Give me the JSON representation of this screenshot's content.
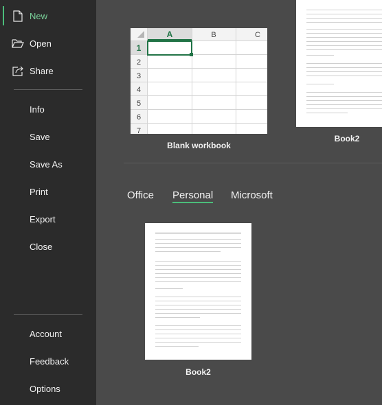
{
  "sidebar": {
    "primary": [
      {
        "icon": "new-document-icon",
        "label": "New",
        "active": true
      },
      {
        "icon": "folder-open-icon",
        "label": "Open"
      },
      {
        "icon": "share-icon",
        "label": "Share"
      }
    ],
    "secondary": [
      "Info",
      "Save",
      "Save As",
      "Print",
      "Export",
      "Close"
    ],
    "footer": [
      "Account",
      "Feedback",
      "Options"
    ]
  },
  "templates": {
    "blank": {
      "caption": "Blank workbook",
      "columns": [
        "A",
        "B",
        "C"
      ],
      "rows": [
        "1",
        "2",
        "3",
        "4",
        "5",
        "6",
        "7"
      ],
      "selected_cell": "A1"
    },
    "top_right": {
      "caption": "Book2"
    }
  },
  "tabs": {
    "items": [
      "Office",
      "Personal",
      "Microsoft"
    ],
    "active": "Personal"
  },
  "personal": {
    "items": [
      {
        "caption": "Book2"
      }
    ]
  },
  "colors": {
    "sidebar_bg": "#2b2b2b",
    "main_bg": "#4a4a4a",
    "accent": "#4bbd7a",
    "cell_selected_border": "#217346"
  }
}
